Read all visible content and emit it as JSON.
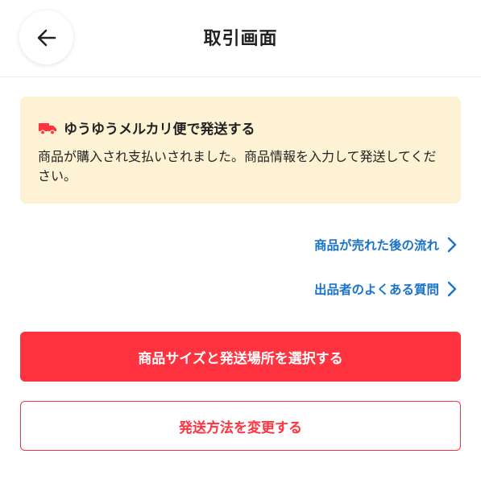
{
  "header": {
    "title": "取引画面",
    "back_icon": "arrow-left-icon"
  },
  "notice": {
    "icon": "truck-icon",
    "title": "ゆうゆうメルカリ便で発送する",
    "body": "商品が購入され支払いされました。商品情報を入力して発送してください。"
  },
  "links": {
    "flow_label": "商品が売れた後の流れ",
    "faq_label": "出品者のよくある質問"
  },
  "actions": {
    "primary_label": "商品サイズと発送場所を選択する",
    "secondary_label": "発送方法を変更する"
  },
  "colors": {
    "accent": "#ff333f",
    "link": "#1a73c8",
    "notice_bg": "#fdf2d4"
  }
}
